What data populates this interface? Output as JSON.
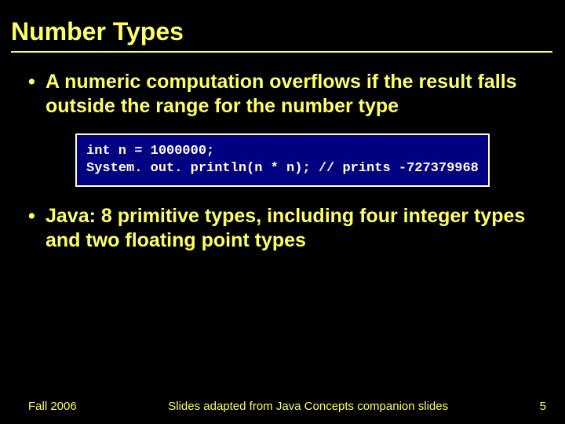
{
  "title": "Number Types",
  "bullets": [
    "A numeric computation overflows if the result falls outside the range for the number type",
    "Java: 8 primitive types, including four integer types and two floating point types"
  ],
  "code": "int n = 1000000;\nSystem. out. println(n * n); // prints -727379968",
  "footer": {
    "left": "Fall 2006",
    "center": "Slides adapted from Java Concepts companion slides",
    "right": "5"
  }
}
